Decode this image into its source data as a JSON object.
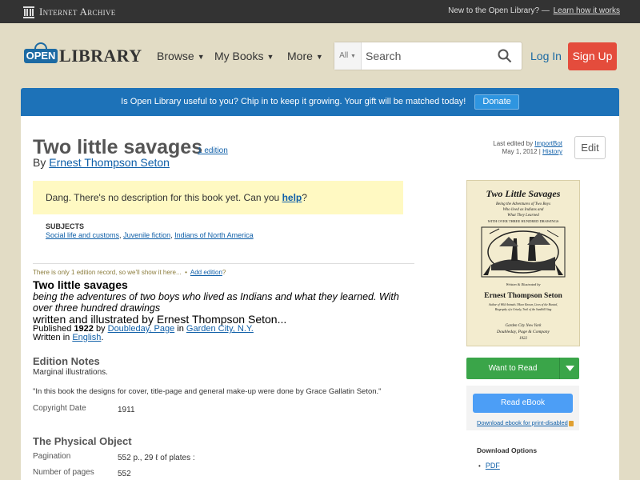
{
  "ia_bar": {
    "brand": "Internet Archive",
    "message": "New to the Open Library? —",
    "link": "Learn how it works"
  },
  "header": {
    "logo_badge": "OPEN",
    "logo_word": "LIBRARY",
    "nav": [
      {
        "label": "Browse"
      },
      {
        "label": "My Books"
      },
      {
        "label": "More"
      }
    ],
    "search": {
      "facet": "All",
      "placeholder": "Search"
    },
    "login": "Log In",
    "signup": "Sign Up"
  },
  "donate": {
    "text": "Is Open Library useful to you? Chip in to keep it growing. Your gift will be matched today!",
    "button": "Donate"
  },
  "book": {
    "title": "Two little savages",
    "edition_count": "1 edition",
    "by": "By",
    "author": "Ernest Thompson Seton",
    "last_edited_prefix": "Last edited by",
    "last_edited_by": "ImportBot",
    "last_edited_date": "May 1, 2012 |",
    "history": "History",
    "edit": "Edit",
    "description_prefix": "Dang. There's no description for this book yet. Can you",
    "description_link": "help",
    "description_suffix": "?",
    "subjects_label": "SUBJECTS",
    "subjects": [
      "Social life and customs",
      "Juvenile fiction",
      "Indians of North America"
    ]
  },
  "edition": {
    "only_note": "There is only 1 edition record, so we'll show it here...",
    "add_edition": "Add edition",
    "add_edition_suffix": "?",
    "title": "Two little savages",
    "subtitle": "being the adventures of two boys who lived as Indians and what they learned. With over three hundred drawings",
    "responsibility": "written and illustrated by Ernest Thompson Seton...",
    "published_label": "Published",
    "year": "1922",
    "by": "by",
    "publisher": "Doubleday, Page",
    "in": "in",
    "place": "Garden City, N.Y.",
    "written_in": "Written in",
    "language": "English",
    "language_suffix": "."
  },
  "edition_notes": {
    "heading": "Edition Notes",
    "notes": "Marginal illustrations.",
    "quote": "\"In this book the designs for cover, title-page and general make-up were done by Grace Gallatin Seton.\"",
    "copyright_label": "Copyright Date",
    "copyright_value": "1911"
  },
  "physical": {
    "heading": "The Physical Object",
    "pagination_label": "Pagination",
    "pagination_value": "552 p., 29 ℓ of plates :",
    "pages_label": "Number of pages",
    "pages_value": "552"
  },
  "cover": {
    "title_line": "Two Little Savages",
    "tag1": "Being the Adventures of Two Boys",
    "tag2": "Who lived as Indians and",
    "tag3": "What They Learned",
    "tag4": "WITH OVER THREE HUNDRED DRAWINGS",
    "illustrated": "Written & Illustrated by",
    "author": "Ernest Thompson Seton",
    "credit1": "Author of Wild Animals I Have Known, Lives of the Hunted,",
    "credit2": "Biography of a Grizzly, Trail of the Sandhill Stag",
    "imprint1": "Garden City     New York",
    "imprint2": "Doubleday, Page & Company",
    "imprint3": "1922"
  },
  "sidebar": {
    "want_to_read": "Want to Read",
    "read_ebook": "Read eBook",
    "print_disabled": "Download ebook for print-disabled",
    "download_options": "Download Options",
    "bullet": "•",
    "pdf": "PDF"
  },
  "colors": {
    "accent_red": "#e44c3c",
    "banner_blue": "#1d72b8",
    "want_green": "#3aa549",
    "read_blue": "#4c9ef6",
    "description_yellow": "#fff9c2"
  }
}
